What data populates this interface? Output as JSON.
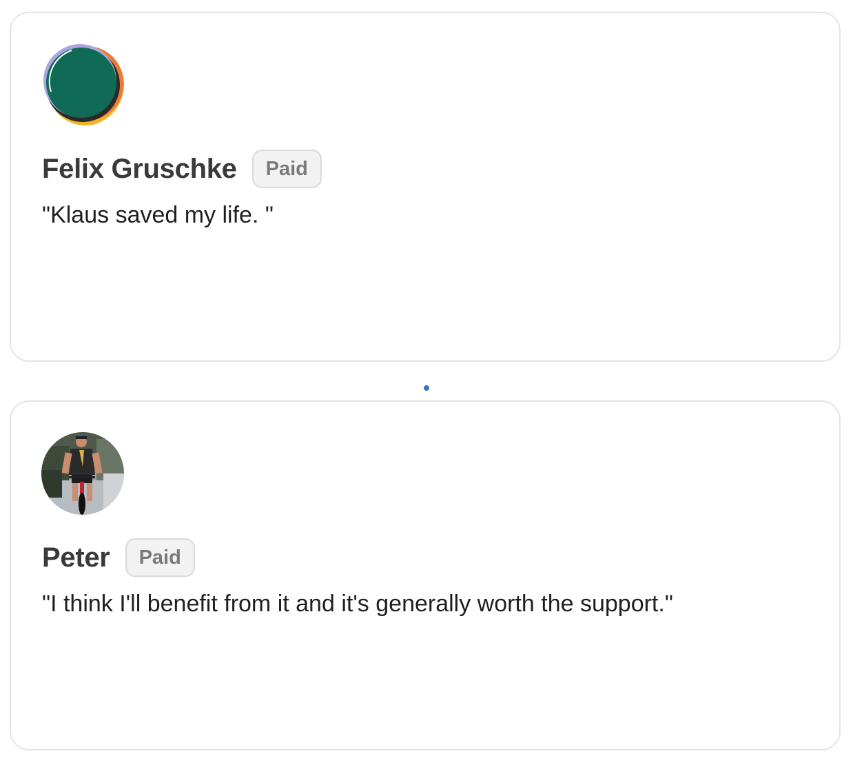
{
  "testimonials": [
    {
      "name": "Felix Gruschke",
      "badge": "Paid",
      "quote": "\"Klaus saved my life. \""
    },
    {
      "name": "Peter",
      "badge": "Paid",
      "quote": "\"I think I'll benefit from it and it's generally worth the support.\""
    }
  ],
  "colors": {
    "avatar_1_main": "#0f6b55",
    "avatar_1_accent_orange": "#f07a35",
    "avatar_1_accent_yellow": "#f4b326",
    "avatar_1_accent_lavender": "#a9a6e0",
    "pager_dot": "#3a73c4"
  },
  "icons": {
    "avatar_1": "abstract-circle-avatar",
    "avatar_2": "cyclist-photo-avatar"
  }
}
